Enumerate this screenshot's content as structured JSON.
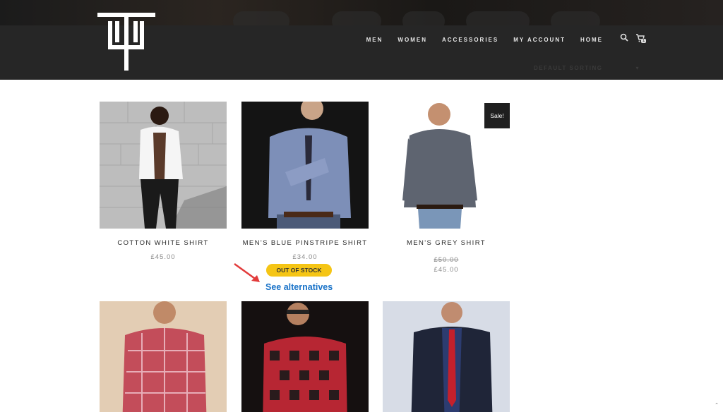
{
  "colors": {
    "header_bg": "#262626",
    "accent_yellow": "#f5c515",
    "link_blue": "#1a73c8",
    "sale_bg": "#1f1f1f"
  },
  "header": {
    "nav": [
      "MEN",
      "WOMEN",
      "ACCESSORIES",
      "MY ACCOUNT",
      "HOME"
    ],
    "cart_count": "1",
    "sorting_label": "DEFAULT SORTING"
  },
  "products": [
    {
      "title": "COTTON WHITE SHIRT",
      "price": "£45.00"
    },
    {
      "title": "MEN'S BLUE PINSTRIPE SHIRT",
      "price": "£34.00"
    },
    {
      "title": "MEN'S GREY SHIRT",
      "old_price": "£50.00",
      "price": "£45.00",
      "badge": "Sale!"
    },
    {
      "title": ""
    },
    {
      "title": ""
    },
    {
      "title": ""
    }
  ],
  "stock": {
    "badge": "OUT OF STOCK",
    "link": "See alternatives"
  },
  "icons": [
    "search-icon",
    "cart-icon",
    "scroll-top-icon",
    "annotation-arrow"
  ]
}
